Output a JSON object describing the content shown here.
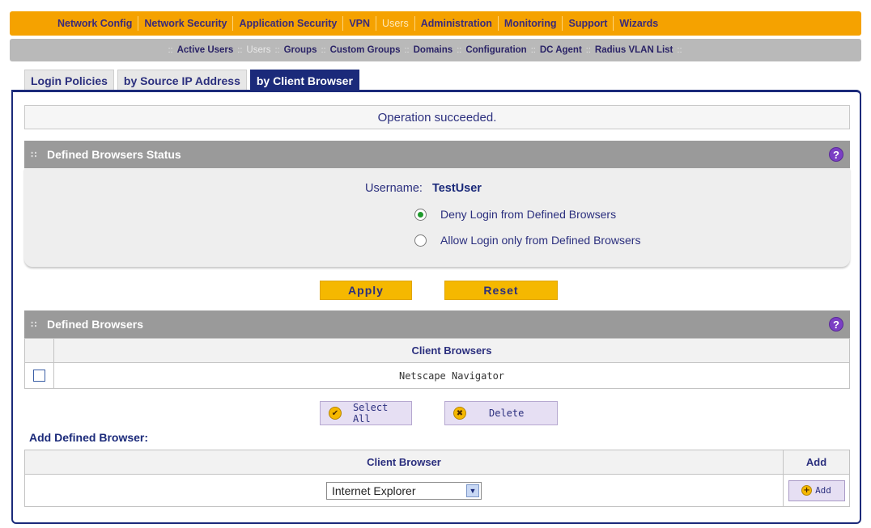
{
  "top_nav": {
    "items": [
      "Network Config",
      "Network Security",
      "Application Security",
      "VPN",
      "Users",
      "Administration",
      "Monitoring",
      "Support",
      "Wizards"
    ],
    "active": "Users"
  },
  "sub_nav": {
    "items": [
      "Active Users",
      "Users",
      "Groups",
      "Custom Groups",
      "Domains",
      "Configuration",
      "DC Agent",
      "Radius VLAN List"
    ],
    "active": "Users"
  },
  "tabs": [
    "Login Policies",
    "by Source IP Address",
    "by Client Browser"
  ],
  "active_tab": "by Client Browser",
  "status_message": "Operation succeeded.",
  "status_section": {
    "title": "Defined Browsers Status",
    "username_label": "Username:",
    "username_value": "TestUser",
    "options": [
      {
        "label": "Deny Login from Defined Browsers",
        "selected": true
      },
      {
        "label": "Allow Login only from Defined Browsers",
        "selected": false
      }
    ]
  },
  "buttons": {
    "apply": "Apply",
    "reset": "Reset",
    "select_all": "Select All",
    "delete": "Delete",
    "add": "Add"
  },
  "defined_browsers": {
    "title": "Defined Browsers",
    "column": "Client Browsers",
    "rows": [
      {
        "name": "Netscape Navigator",
        "checked": false
      }
    ]
  },
  "add_section": {
    "label": "Add Defined Browser:",
    "col_browser": "Client Browser",
    "col_add": "Add",
    "selected_browser": "Internet Explorer"
  },
  "colors": {
    "nav_orange": "#f5a200",
    "navy": "#1b2a7a",
    "button_yellow": "#f5b800",
    "section_gray": "#9a9a9a"
  },
  "icons": {
    "help": "help-icon",
    "select_all": "check-circle-icon",
    "delete": "x-circle-icon",
    "add": "plus-circle-icon",
    "dropdown": "chevron-down-icon"
  }
}
